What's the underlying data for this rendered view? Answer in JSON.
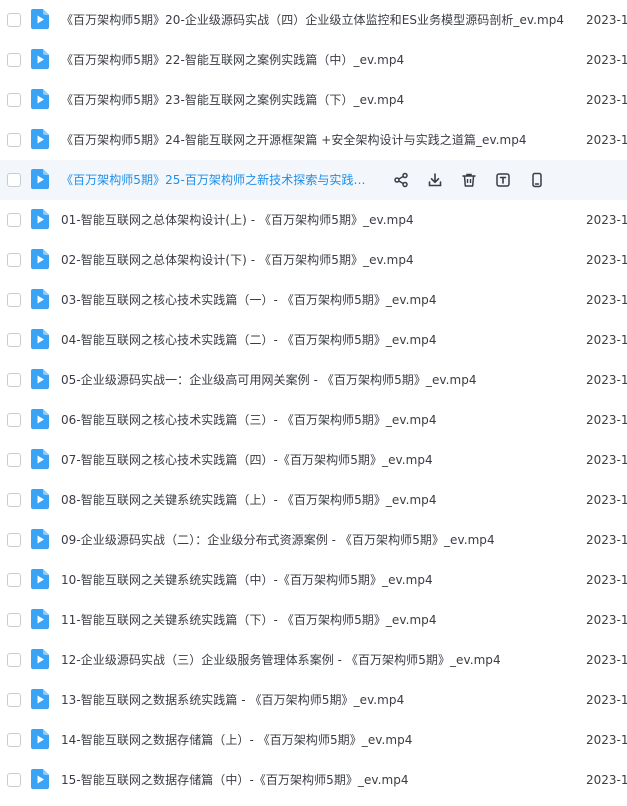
{
  "files": [
    {
      "name": "《百万架构师5期》20-企业级源码实战（四）企业级立体监控和ES业务模型源码剖析_ev.mp4",
      "date": "2023-1"
    },
    {
      "name": "《百万架构师5期》22-智能互联网之案例实践篇（中）_ev.mp4",
      "date": "2023-1"
    },
    {
      "name": "《百万架构师5期》23-智能互联网之案例实践篇（下）_ev.mp4",
      "date": "2023-1"
    },
    {
      "name": "《百万架构师5期》24-智能互联网之开源框架篇 +安全架构设计与实践之道篇_ev.mp4",
      "date": "2023-1"
    },
    {
      "name": "《百万架构师5期》25-百万架构师之新技术探索与实践篇...",
      "date": "",
      "hovered": true
    },
    {
      "name": "01-智能互联网之总体架构设计(上) - 《百万架构师5期》_ev.mp4",
      "date": "2023-1"
    },
    {
      "name": "02-智能互联网之总体架构设计(下) - 《百万架构师5期》_ev.mp4",
      "date": "2023-1"
    },
    {
      "name": "03-智能互联网之核心技术实践篇（一）- 《百万架构师5期》_ev.mp4",
      "date": "2023-1"
    },
    {
      "name": "04-智能互联网之核心技术实践篇（二）- 《百万架构师5期》_ev.mp4",
      "date": "2023-1"
    },
    {
      "name": "05-企业级源码实战一：企业级高可用网关案例 - 《百万架构师5期》_ev.mp4",
      "date": "2023-1"
    },
    {
      "name": "06-智能互联网之核心技术实践篇（三）- 《百万架构师5期》_ev.mp4",
      "date": "2023-1"
    },
    {
      "name": "07-智能互联网之核心技术实践篇（四）-《百万架构师5期》_ev.mp4",
      "date": "2023-1"
    },
    {
      "name": "08-智能互联网之关键系统实践篇（上）- 《百万架构师5期》_ev.mp4",
      "date": "2023-1"
    },
    {
      "name": "09-企业级源码实战（二）：企业级分布式资源案例 - 《百万架构师5期》_ev.mp4",
      "date": "2023-1"
    },
    {
      "name": "10-智能互联网之关键系统实践篇（中）-《百万架构师5期》_ev.mp4",
      "date": "2023-1"
    },
    {
      "name": "11-智能互联网之关键系统实践篇（下）- 《百万架构师5期》_ev.mp4",
      "date": "2023-1"
    },
    {
      "name": "12-企业级源码实战（三）企业级服务管理体系案例 - 《百万架构师5期》_ev.mp4",
      "date": "2023-1"
    },
    {
      "name": "13-智能互联网之数据系统实践篇 - 《百万架构师5期》_ev.mp4",
      "date": "2023-1"
    },
    {
      "name": "14-智能互联网之数据存储篇（上）- 《百万架构师5期》_ev.mp4",
      "date": "2023-1"
    },
    {
      "name": "15-智能互联网之数据存储篇（中）-《百万架构师5期》_ev.mp4",
      "date": "2023-1"
    }
  ],
  "hover_actions": [
    {
      "icon": "share-icon"
    },
    {
      "icon": "download-icon"
    },
    {
      "icon": "delete-icon"
    },
    {
      "icon": "text-recognize-icon"
    },
    {
      "icon": "mobile-icon"
    }
  ],
  "colors": {
    "file_icon": "#3ba3f5",
    "hover_text": "#1f8fe8",
    "hover_bg": "#f3f6fb",
    "text": "#3a3d44"
  }
}
